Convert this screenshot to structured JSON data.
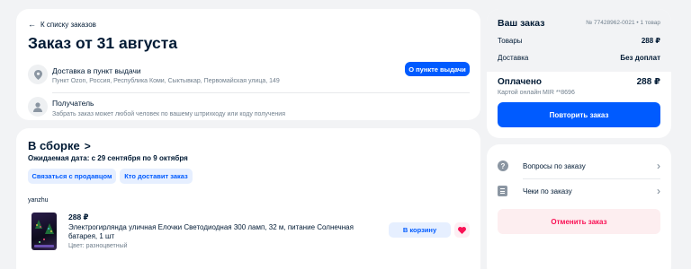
{
  "back_link": {
    "label": "К списку заказов"
  },
  "order_header": {
    "title": "Заказ от 31 августа"
  },
  "delivery": {
    "title": "Доставка в пункт выдачи",
    "address": "Пункт Ozon, Россия, Республика Коми, Сыктывкар, Первомайская улица, 149",
    "button_label": "О пункте выдачи",
    "icon": "location-pin-icon"
  },
  "recipient": {
    "title": "Получатель",
    "hint": "Забрать заказ может любой человек по вашему штрихкоду или коду получения",
    "icon": "person-icon"
  },
  "shipment": {
    "status": "В сборке",
    "status_arrow": ">",
    "expected_label": "Ожидаемая дата: с 29 сентября по 9 октября",
    "contact_seller_label": "Связаться с продавцом",
    "who_delivers_label": "Кто доставит заказ",
    "seller_name": "yanzhu",
    "item": {
      "price": "288 ₽",
      "name": "Электрогирлянда уличная Елочки Светодиодная 300 ламп, 32 м, питание Солнечная батарея, 1 шт",
      "color": "Цвет: разноцветный",
      "cart_label": "В корзину",
      "favorite_icon": "heart-icon"
    }
  },
  "summary": {
    "title": "Ваш заказ",
    "order_meta": "№ 77428962-0021 • 1 товар",
    "goods_label": "Товары",
    "goods_value": "288 ₽",
    "delivery_label": "Доставка",
    "delivery_value": "Без доплат",
    "paid_label": "Оплачено",
    "paid_value": "288 ₽",
    "payment_method": "Картой онлайн MIR **8696",
    "repeat_label": "Повторить заказ"
  },
  "actions": {
    "questions_label": "Вопросы по заказу",
    "receipts_label": "Чеки по заказу",
    "cancel_label": "Отменить заказ",
    "arrow": "›"
  },
  "colors": {
    "accent": "#005bff",
    "accent_light": "#e6efff",
    "danger": "#f91155",
    "danger_bg": "#fdeef0",
    "background": "#f2f3f5"
  }
}
